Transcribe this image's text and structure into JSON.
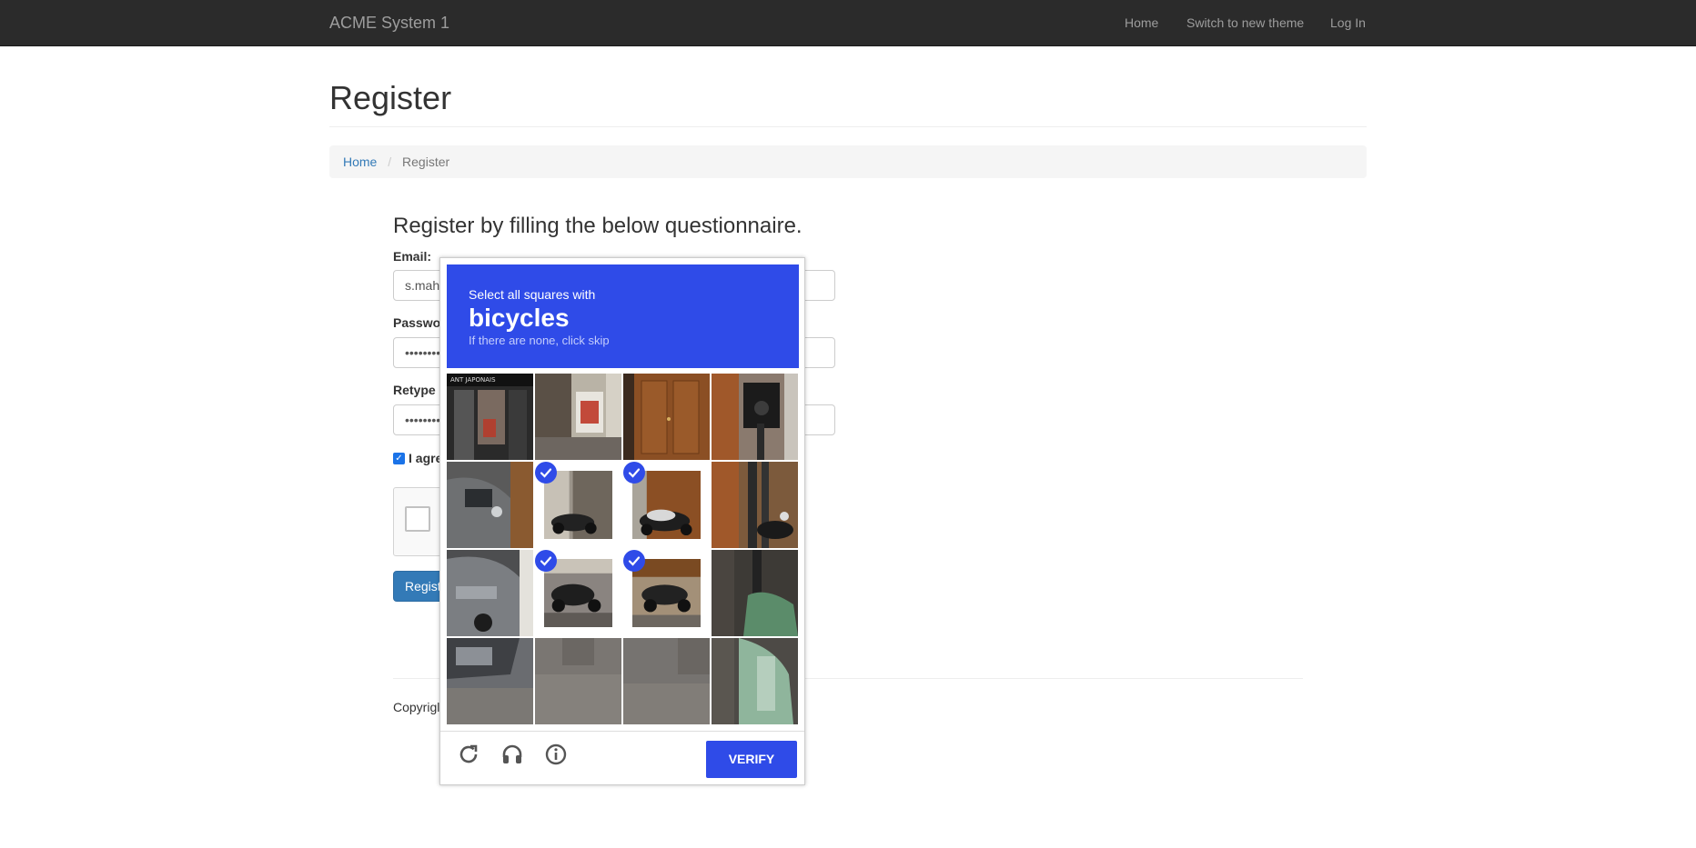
{
  "navbar": {
    "brand": "ACME System 1",
    "links": [
      "Home",
      "Switch to new theme",
      "Log In"
    ]
  },
  "page": {
    "title": "Register",
    "breadcrumb": {
      "home": "Home",
      "current": "Register"
    }
  },
  "form": {
    "heading": "Register by filling the below questionnaire.",
    "email_label": "Email:",
    "email_value": "s.mah",
    "password_label": "Passwo",
    "password_value": "••••••••",
    "retype_label": "Retype",
    "retype_value": "••••••••",
    "agree_label": "I agre",
    "agree_checked": true,
    "register_label": "Regist"
  },
  "footer": {
    "text": "Copyrigl"
  },
  "challenge": {
    "instruction": "Select all squares with",
    "keyword": "bicycles",
    "hint": "If there are none, click skip",
    "verify_label": "VERIFY",
    "accent_color": "#2f4be8",
    "selected_tiles": [
      5,
      6,
      9,
      10
    ],
    "tiles": [
      {
        "scene": "shop-front",
        "selected": false
      },
      {
        "scene": "shop-window",
        "selected": false
      },
      {
        "scene": "wooden-door",
        "selected": false
      },
      {
        "scene": "traffic-light",
        "selected": false
      },
      {
        "scene": "car-side",
        "selected": false
      },
      {
        "scene": "scooter-top",
        "selected": true
      },
      {
        "scene": "scooter-top-door",
        "selected": true
      },
      {
        "scene": "pole-street",
        "selected": false
      },
      {
        "scene": "car-rear",
        "selected": false
      },
      {
        "scene": "scooter-bottom",
        "selected": true
      },
      {
        "scene": "scooter-bottom-right",
        "selected": true
      },
      {
        "scene": "pole-bag",
        "selected": false
      },
      {
        "scene": "car-bumper",
        "selected": false
      },
      {
        "scene": "pavement",
        "selected": false
      },
      {
        "scene": "pavement-2",
        "selected": false
      },
      {
        "scene": "green-bag",
        "selected": false
      }
    ],
    "icons": [
      "reload-icon",
      "audio-icon",
      "info-icon"
    ]
  }
}
